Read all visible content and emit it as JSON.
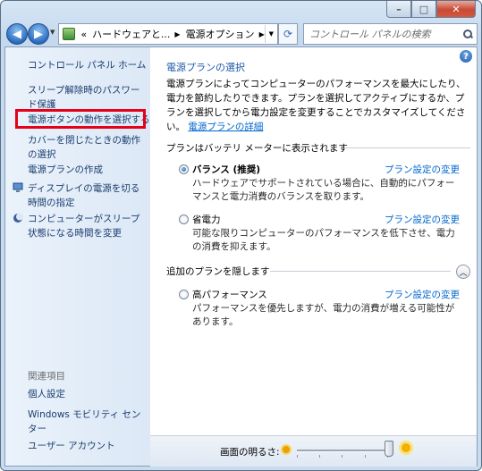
{
  "window": {
    "caption_buttons": [
      "minimize",
      "maximize",
      "close"
    ]
  },
  "address": {
    "breadcrumb_prefix": "«",
    "crumbs": [
      "ハードウェアと...",
      "電源オプション"
    ],
    "search_placeholder": "コントロール パネルの検索"
  },
  "sidebar": {
    "home": "コントロール パネル ホーム",
    "items": [
      "スリープ解除時のパスワード保護",
      "電源ボタンの動作を選択する",
      "カバーを閉じたときの動作の選択",
      "電源プランの作成",
      "ディスプレイの電源を切る時間の指定",
      "コンピューターがスリープ状態になる時間を変更"
    ],
    "see_also_heading": "関連項目",
    "see_also": [
      "個人設定",
      "Windows モビリティ センター",
      "ユーザー アカウント"
    ]
  },
  "main": {
    "title": "電源プランの選択",
    "description": "電源プランによってコンピューターのパフォーマンスを最大にしたり、電力を節約したりできます。プランを選択してアクティブにするか、プランを選択してから電力設定を変更することでカスタマイズしてください。",
    "description_link": "電源プランの詳細",
    "battery_group": "プランはバッテリ メーターに表示されます",
    "hidden_group": "追加のプランを隠します",
    "change_link": "プラン設定の変更",
    "plans": [
      {
        "name": "バランス (推奨)",
        "selected": true,
        "desc": "ハードウェアでサポートされている場合に、自動的にパフォーマンスと電力消費のバランスを取ります。"
      },
      {
        "name": "省電力",
        "selected": false,
        "desc": "可能な限りコンピューターのパフォーマンスを低下させ、電力の消費を抑えます。"
      },
      {
        "name": "高パフォーマンス",
        "selected": false,
        "desc": "パフォーマンスを優先しますが、電力の消費が増える可能性があります。"
      }
    ]
  },
  "brightness": {
    "label": "画面の明るさ:",
    "level": 1.0
  }
}
